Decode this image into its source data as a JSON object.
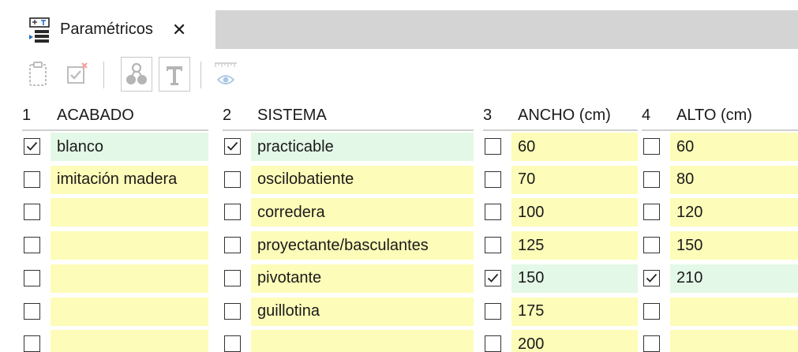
{
  "tab": {
    "title": "Paramétricos",
    "close_glyph": "✕",
    "icon": "parametric-table-icon"
  },
  "toolbar": {
    "buttons": [
      {
        "icon": "clipboard-icon",
        "enabled": false
      },
      {
        "icon": "check-delete-icon",
        "enabled": false
      },
      {
        "icon": "tree-nodes-icon",
        "enabled": false
      },
      {
        "icon": "text-t-icon",
        "enabled": false
      },
      {
        "icon": "ruler-eye-icon",
        "enabled": false
      }
    ]
  },
  "columns": [
    {
      "num": "1",
      "label": "ACABADO"
    },
    {
      "num": "2",
      "label": "SISTEMA"
    },
    {
      "num": "3",
      "label": "ANCHO (cm)"
    },
    {
      "num": "4",
      "label": "ALTO (cm)"
    }
  ],
  "rows": [
    {
      "cells": [
        {
          "checked": true,
          "value": "blanco"
        },
        {
          "checked": true,
          "value": "practicable"
        },
        {
          "checked": false,
          "value": "60"
        },
        {
          "checked": false,
          "value": "60"
        }
      ]
    },
    {
      "cells": [
        {
          "checked": false,
          "value": "imitación madera"
        },
        {
          "checked": false,
          "value": "oscilobatiente"
        },
        {
          "checked": false,
          "value": "70"
        },
        {
          "checked": false,
          "value": "80"
        }
      ]
    },
    {
      "cells": [
        {
          "checked": false,
          "value": ""
        },
        {
          "checked": false,
          "value": "corredera"
        },
        {
          "checked": false,
          "value": "100"
        },
        {
          "checked": false,
          "value": "120"
        }
      ]
    },
    {
      "cells": [
        {
          "checked": false,
          "value": ""
        },
        {
          "checked": false,
          "value": "proyectante/basculantes"
        },
        {
          "checked": false,
          "value": "125"
        },
        {
          "checked": false,
          "value": "150"
        }
      ]
    },
    {
      "cells": [
        {
          "checked": false,
          "value": ""
        },
        {
          "checked": false,
          "value": "pivotante"
        },
        {
          "checked": true,
          "value": "150"
        },
        {
          "checked": true,
          "value": "210"
        }
      ]
    },
    {
      "cells": [
        {
          "checked": false,
          "value": ""
        },
        {
          "checked": false,
          "value": "guillotina"
        },
        {
          "checked": false,
          "value": "175"
        },
        {
          "checked": false,
          "value": ""
        }
      ]
    },
    {
      "cells": [
        {
          "checked": false,
          "value": ""
        },
        {
          "checked": false,
          "value": ""
        },
        {
          "checked": false,
          "value": "200"
        },
        {
          "checked": false,
          "value": ""
        }
      ]
    }
  ],
  "colors": {
    "empty_cell": "#fdfcb8",
    "checked_cell": "#e3f8e6",
    "tab_strip": "#d4d4d4",
    "accent_blue": "#1f6fc5"
  }
}
